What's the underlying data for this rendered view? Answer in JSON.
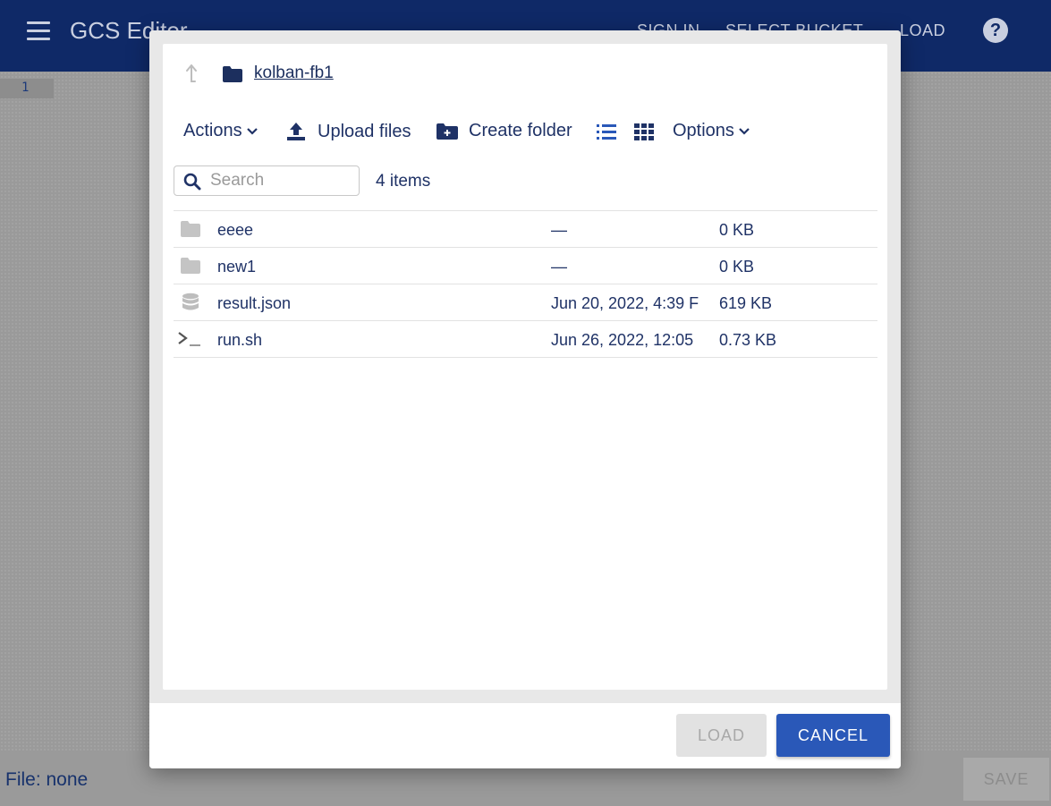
{
  "app": {
    "title": "GCS Editor",
    "nav": {
      "sign_in": "SIGN IN",
      "select_bucket": "SELECT BUCKET",
      "load": "LOAD",
      "help_icon": "help-icon"
    },
    "editor": {
      "line_number": "1"
    },
    "status": {
      "file": "File: none",
      "save_label": "SAVE"
    }
  },
  "dialog": {
    "breadcrumb": {
      "up_icon": "arrow-up-icon",
      "folder_icon": "folder-icon",
      "current": "kolban-fb1"
    },
    "toolbar": {
      "actions": "Actions",
      "upload": "Upload files",
      "create_folder": "Create folder",
      "view_list_icon": "list-view-icon",
      "view_grid_icon": "grid-view-icon",
      "options": "Options"
    },
    "search": {
      "placeholder": "Search",
      "value": ""
    },
    "item_count": "4 items",
    "files": [
      {
        "icon": "folder-icon",
        "name": "eeee",
        "modified": "—",
        "size": "0 KB"
      },
      {
        "icon": "folder-icon",
        "name": "new1",
        "modified": "—",
        "size": "0 KB"
      },
      {
        "icon": "database-icon",
        "name": "result.json",
        "modified": "Jun 20, 2022, 4:39 F",
        "size": "619 KB"
      },
      {
        "icon": "terminal-icon",
        "name": "run.sh",
        "modified": "Jun 26, 2022, 12:05",
        "size": "0.73 KB"
      }
    ],
    "buttons": {
      "load": "LOAD",
      "cancel": "CANCEL"
    }
  },
  "colors": {
    "appbar": "#0f2967",
    "primary_button": "#2a58b8",
    "text": "#1f3266"
  }
}
